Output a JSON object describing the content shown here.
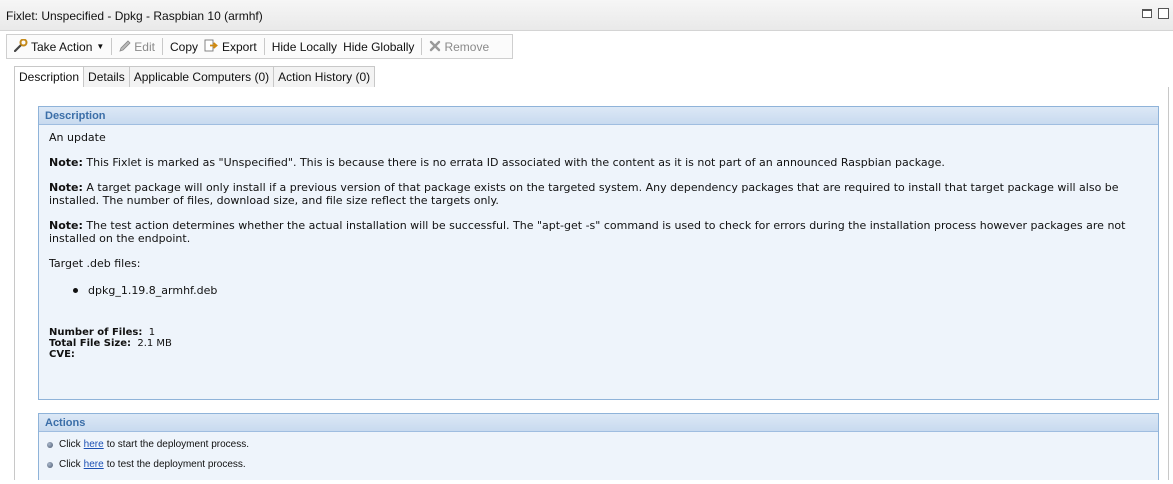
{
  "window": {
    "title": "Fixlet: Unspecified - Dpkg - Raspbian 10 (armhf)"
  },
  "toolbar": {
    "take_action": "Take Action",
    "edit": "Edit",
    "copy": "Copy",
    "export": "Export",
    "hide_locally": "Hide Locally",
    "hide_globally": "Hide Globally",
    "remove": "Remove"
  },
  "tabs": [
    {
      "label": "Description",
      "active": true
    },
    {
      "label": "Details"
    },
    {
      "label": "Applicable Computers (0)"
    },
    {
      "label": "Action History (0)"
    }
  ],
  "description": {
    "header": "Description",
    "intro": "An update",
    "notes": [
      {
        "label": "Note:",
        "text": "This Fixlet is marked as \"Unspecified\". This is because there is no errata ID associated with the content as it is not part of an announced Raspbian package."
      },
      {
        "label": "Note:",
        "text": "A target package will only install if a previous version of that package exists on the targeted system. Any dependency packages that are required to install that target package will also be installed. The number of files, download size, and file size reflect the targets only."
      },
      {
        "label": "Note:",
        "text": "The test action determines whether the actual installation will be successful. The \"apt-get -s\" command is used to check for errors during the installation process however packages are not installed on the endpoint."
      }
    ],
    "target_label": "Target .deb files:",
    "files": [
      "dpkg_1.19.8_armhf.deb"
    ],
    "number_of_files_label": "Number of Files:",
    "number_of_files_value": "1",
    "total_file_size_label": "Total File Size:",
    "total_file_size_value": "2.1 MB",
    "cve_label": "CVE:"
  },
  "actions": {
    "header": "Actions",
    "items": [
      {
        "prefix": "Click",
        "link": "here",
        "suffix": "to start the deployment process."
      },
      {
        "prefix": "Click",
        "link": "here",
        "suffix": "to test the deployment process."
      }
    ]
  }
}
